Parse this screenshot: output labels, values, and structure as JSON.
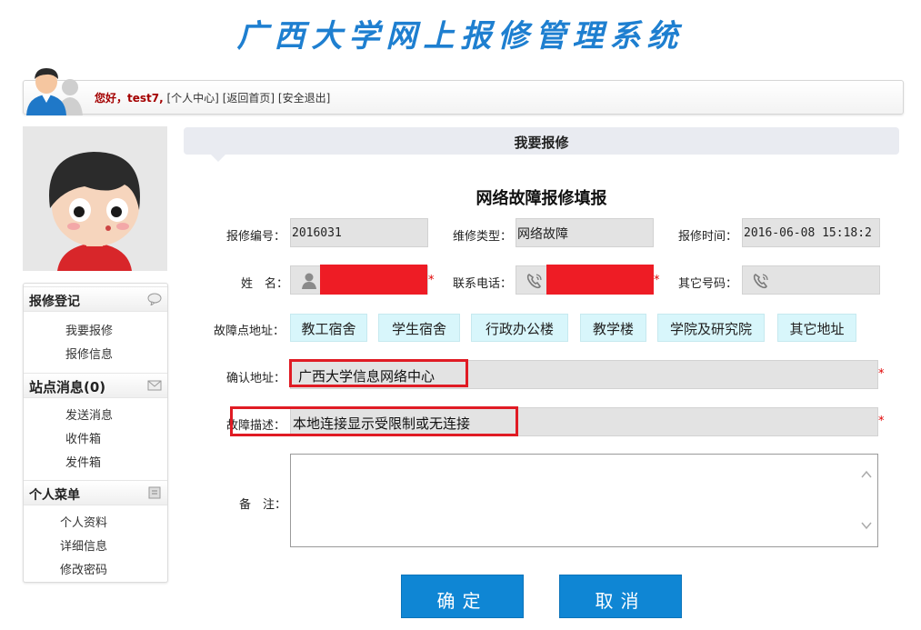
{
  "app": {
    "title": "广西大学网上报修管理系统"
  },
  "userbar": {
    "greeting": "您好，test7,",
    "links": [
      "[个人中心]",
      "[返回首页]",
      "[安全退出]"
    ]
  },
  "sidebar": {
    "sections": [
      {
        "title": "报修登记",
        "icon": "chat-bubble-icon",
        "items": [
          "我要报修",
          "报修信息"
        ]
      },
      {
        "title": "站点消息(0)",
        "icon": "mail-icon",
        "items": [
          "发送消息",
          "收件箱",
          "发件箱"
        ]
      },
      {
        "title": "个人菜单",
        "icon": "note-icon",
        "items": [
          "个人资料",
          "详细信息",
          "修改密码"
        ]
      }
    ]
  },
  "main": {
    "header": "我要报修",
    "form_title": "网络故障报修填报",
    "labels": {
      "repair_no": "报修编号：",
      "repair_type": "维修类型：",
      "repair_time": "报修时间：",
      "name": "姓　名：",
      "phone": "联系电话：",
      "other_phone": "其它号码：",
      "location": "故障点地址：",
      "confirm_address": "确认地址：",
      "description": "故障描述：",
      "remarks": "备　注："
    },
    "values": {
      "repair_no": "2016031",
      "repair_type": "网络故障",
      "repair_time": "2016-06-08 15:18:2",
      "confirm_address": "广西大学信息网络中心",
      "description": "本地连接显示受限制或无连接"
    },
    "location_options": [
      "教工宿舍",
      "学生宿舍",
      "行政办公楼",
      "教学楼",
      "学院及研究院",
      "其它地址"
    ],
    "required_mark": "*",
    "buttons": {
      "ok": "确定",
      "cancel": "取消"
    }
  },
  "colors": {
    "title_blue": "#1e7fd0",
    "button_blue": "#0f86d4",
    "highlight_red": "#e01b24",
    "option_cyan": "#d8f6fb"
  }
}
